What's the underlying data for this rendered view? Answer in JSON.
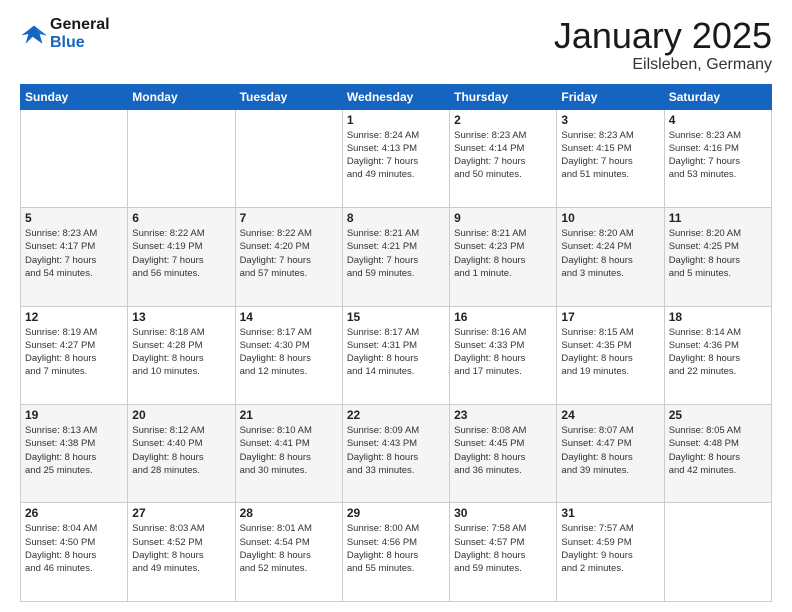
{
  "logo": {
    "line1": "General",
    "line2": "Blue"
  },
  "title": "January 2025",
  "subtitle": "Eilsleben, Germany",
  "headers": [
    "Sunday",
    "Monday",
    "Tuesday",
    "Wednesday",
    "Thursday",
    "Friday",
    "Saturday"
  ],
  "weeks": [
    [
      {
        "day": "",
        "info": ""
      },
      {
        "day": "",
        "info": ""
      },
      {
        "day": "",
        "info": ""
      },
      {
        "day": "1",
        "info": "Sunrise: 8:24 AM\nSunset: 4:13 PM\nDaylight: 7 hours\nand 49 minutes."
      },
      {
        "day": "2",
        "info": "Sunrise: 8:23 AM\nSunset: 4:14 PM\nDaylight: 7 hours\nand 50 minutes."
      },
      {
        "day": "3",
        "info": "Sunrise: 8:23 AM\nSunset: 4:15 PM\nDaylight: 7 hours\nand 51 minutes."
      },
      {
        "day": "4",
        "info": "Sunrise: 8:23 AM\nSunset: 4:16 PM\nDaylight: 7 hours\nand 53 minutes."
      }
    ],
    [
      {
        "day": "5",
        "info": "Sunrise: 8:23 AM\nSunset: 4:17 PM\nDaylight: 7 hours\nand 54 minutes."
      },
      {
        "day": "6",
        "info": "Sunrise: 8:22 AM\nSunset: 4:19 PM\nDaylight: 7 hours\nand 56 minutes."
      },
      {
        "day": "7",
        "info": "Sunrise: 8:22 AM\nSunset: 4:20 PM\nDaylight: 7 hours\nand 57 minutes."
      },
      {
        "day": "8",
        "info": "Sunrise: 8:21 AM\nSunset: 4:21 PM\nDaylight: 7 hours\nand 59 minutes."
      },
      {
        "day": "9",
        "info": "Sunrise: 8:21 AM\nSunset: 4:23 PM\nDaylight: 8 hours\nand 1 minute."
      },
      {
        "day": "10",
        "info": "Sunrise: 8:20 AM\nSunset: 4:24 PM\nDaylight: 8 hours\nand 3 minutes."
      },
      {
        "day": "11",
        "info": "Sunrise: 8:20 AM\nSunset: 4:25 PM\nDaylight: 8 hours\nand 5 minutes."
      }
    ],
    [
      {
        "day": "12",
        "info": "Sunrise: 8:19 AM\nSunset: 4:27 PM\nDaylight: 8 hours\nand 7 minutes."
      },
      {
        "day": "13",
        "info": "Sunrise: 8:18 AM\nSunset: 4:28 PM\nDaylight: 8 hours\nand 10 minutes."
      },
      {
        "day": "14",
        "info": "Sunrise: 8:17 AM\nSunset: 4:30 PM\nDaylight: 8 hours\nand 12 minutes."
      },
      {
        "day": "15",
        "info": "Sunrise: 8:17 AM\nSunset: 4:31 PM\nDaylight: 8 hours\nand 14 minutes."
      },
      {
        "day": "16",
        "info": "Sunrise: 8:16 AM\nSunset: 4:33 PM\nDaylight: 8 hours\nand 17 minutes."
      },
      {
        "day": "17",
        "info": "Sunrise: 8:15 AM\nSunset: 4:35 PM\nDaylight: 8 hours\nand 19 minutes."
      },
      {
        "day": "18",
        "info": "Sunrise: 8:14 AM\nSunset: 4:36 PM\nDaylight: 8 hours\nand 22 minutes."
      }
    ],
    [
      {
        "day": "19",
        "info": "Sunrise: 8:13 AM\nSunset: 4:38 PM\nDaylight: 8 hours\nand 25 minutes."
      },
      {
        "day": "20",
        "info": "Sunrise: 8:12 AM\nSunset: 4:40 PM\nDaylight: 8 hours\nand 28 minutes."
      },
      {
        "day": "21",
        "info": "Sunrise: 8:10 AM\nSunset: 4:41 PM\nDaylight: 8 hours\nand 30 minutes."
      },
      {
        "day": "22",
        "info": "Sunrise: 8:09 AM\nSunset: 4:43 PM\nDaylight: 8 hours\nand 33 minutes."
      },
      {
        "day": "23",
        "info": "Sunrise: 8:08 AM\nSunset: 4:45 PM\nDaylight: 8 hours\nand 36 minutes."
      },
      {
        "day": "24",
        "info": "Sunrise: 8:07 AM\nSunset: 4:47 PM\nDaylight: 8 hours\nand 39 minutes."
      },
      {
        "day": "25",
        "info": "Sunrise: 8:05 AM\nSunset: 4:48 PM\nDaylight: 8 hours\nand 42 minutes."
      }
    ],
    [
      {
        "day": "26",
        "info": "Sunrise: 8:04 AM\nSunset: 4:50 PM\nDaylight: 8 hours\nand 46 minutes."
      },
      {
        "day": "27",
        "info": "Sunrise: 8:03 AM\nSunset: 4:52 PM\nDaylight: 8 hours\nand 49 minutes."
      },
      {
        "day": "28",
        "info": "Sunrise: 8:01 AM\nSunset: 4:54 PM\nDaylight: 8 hours\nand 52 minutes."
      },
      {
        "day": "29",
        "info": "Sunrise: 8:00 AM\nSunset: 4:56 PM\nDaylight: 8 hours\nand 55 minutes."
      },
      {
        "day": "30",
        "info": "Sunrise: 7:58 AM\nSunset: 4:57 PM\nDaylight: 8 hours\nand 59 minutes."
      },
      {
        "day": "31",
        "info": "Sunrise: 7:57 AM\nSunset: 4:59 PM\nDaylight: 9 hours\nand 2 minutes."
      },
      {
        "day": "",
        "info": ""
      }
    ]
  ]
}
